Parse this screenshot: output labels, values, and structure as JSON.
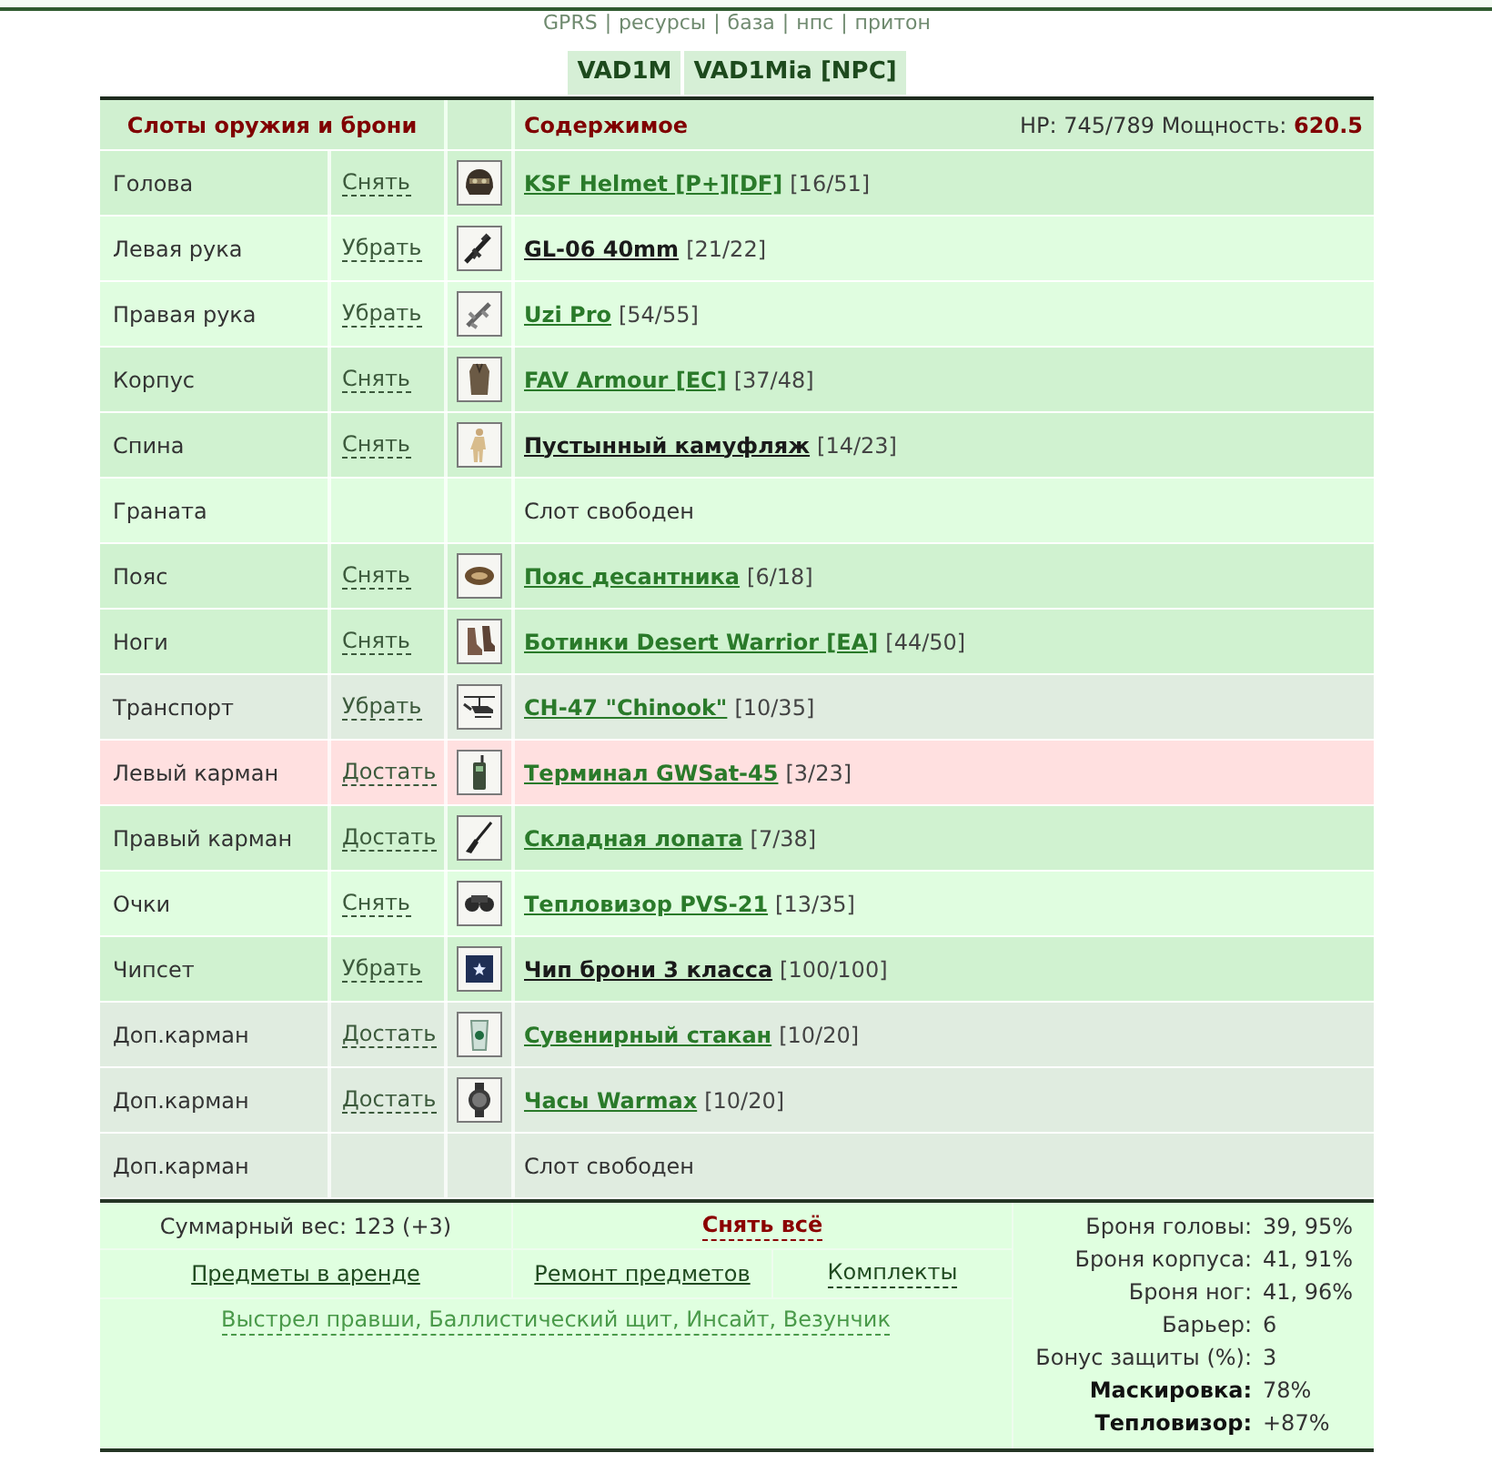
{
  "top_nav": {
    "links": [
      "GPRS",
      "ресурсы",
      "база",
      "нпс",
      "притон"
    ],
    "separator": "|"
  },
  "character_tabs": [
    {
      "label": "VAD1M"
    },
    {
      "label": "VAD1Mia [NPC]"
    }
  ],
  "table": {
    "columns": [
      "Слоты оружия и брони",
      "Содержимое"
    ],
    "stats": "HP: 745/789 Мощность: **620.5**",
    "rows": [
      {
        "slot": "Голова",
        "kind": "item",
        "action": "Снять",
        "color": "#d0f2d0",
        "item": {
          "name": "KSF Helmet [P+][DF]",
          "durability": "[16/51]",
          "color": "#2a7a2a"
        }
      },
      {
        "slot": "Левая рука",
        "kind": "item",
        "action": "Убрать",
        "color": "#e0fde0",
        "item": {
          "name": "GL-06 40mm",
          "durability": "[21/22]",
          "color": "#1a1a1a"
        }
      },
      {
        "slot": "Правая рука",
        "kind": "item",
        "action": "Убрать",
        "color": "#e0fde0",
        "item": {
          "name": "Uzi Pro",
          "durability": "[54/55]",
          "color": "#2a7a2a"
        }
      },
      {
        "slot": "Корпус",
        "kind": "item",
        "action": "Снять",
        "color": "#d0f2d0",
        "item": {
          "name": "FAV Armour [EC]",
          "durability": "[37/48]",
          "color": "#2a7a2a"
        }
      },
      {
        "slot": "Спина",
        "kind": "item",
        "action": "Снять",
        "color": "#d0f2d0",
        "item": {
          "name": "Пустынный камуфляж",
          "durability": "[14/23]",
          "color": "#1a1a1a"
        }
      },
      {
        "slot": "Граната",
        "kind": "empty",
        "color": "#e0fde0",
        "text": "Слот свободен"
      },
      {
        "slot": "Пояс",
        "kind": "item",
        "action": "Снять",
        "color": "#d0f2d0",
        "item": {
          "name": "Пояс десантника",
          "durability": "[6/18]",
          "color": "#2a7a2a"
        }
      },
      {
        "slot": "Ноги",
        "kind": "item",
        "action": "Снять",
        "color": "#d0f2d0",
        "item": {
          "name": "Ботинки Desert Warrior [EA]",
          "durability": "[44/50]",
          "color": "#2a7a2a"
        }
      },
      {
        "slot": "Транспорт",
        "kind": "item",
        "action": "Убрать",
        "color": "#e0ece0",
        "item": {
          "name": "CH-47 \"Chinook\"",
          "durability": "[10/35]",
          "color": "#2a7a2a"
        }
      },
      {
        "slot": "Левый карман",
        "kind": "item",
        "action": "Достать",
        "color": "#ffe0e0",
        "item": {
          "name": "Терминал GWSat-45",
          "durability": "[3/23]",
          "color": "#2a7a2a"
        }
      },
      {
        "slot": "Правый карман",
        "kind": "item",
        "action": "Достать",
        "color": "#d0f2d0",
        "item": {
          "name": "Складная лопата",
          "durability": "[7/38]",
          "color": "#2a7a2a"
        }
      },
      {
        "slot": "Очки",
        "kind": "item",
        "action": "Снять",
        "color": "#e0fde0",
        "item": {
          "name": "Тепловизор PVS-21",
          "durability": "[13/35]",
          "color": "#2a7a2a"
        }
      },
      {
        "slot": "Чипсет",
        "kind": "item",
        "action": "Убрать",
        "color": "#d0f2d0",
        "item": {
          "name": "Чип брони 3 класса",
          "durability": "[100/100]",
          "color": "#1a1a1a"
        }
      },
      {
        "slot": "Доп.карман",
        "kind": "item",
        "action": "Достать",
        "color": "#e0ece0",
        "item": {
          "name": "Сувенирный стакан",
          "durability": "[10/20]",
          "color": "#2a7a2a"
        }
      },
      {
        "slot": "Доп.карман",
        "kind": "item",
        "action": "Достать",
        "color": "#e0ece0",
        "item": {
          "name": "Часы Warmax",
          "durability": "[10/20]",
          "color": "#2a7a2a"
        }
      },
      {
        "slot": "Доп.карман",
        "kind": "empty",
        "color": "#e0ece0",
        "text": "Слот свободен"
      }
    ]
  },
  "footer": {
    "weight": "Суммарный вес: 123 (+3)",
    "remove_all": "Снять всё",
    "links": [
      {
        "label": "Предметы в аренде",
        "kind": "solid"
      },
      {
        "label": "Ремонт предметов",
        "kind": "solid"
      },
      {
        "label": "Комплекты",
        "kind": "dashed"
      }
    ],
    "abilities": "Выстрел правши, Баллистический щит, Инсайт, Везунчик",
    "stats": [
      {
        "label": "Броня головы:",
        "value": "39, 95%",
        "bold": false
      },
      {
        "label": "Броня корпуса:",
        "value": "41, 91%",
        "bold": false
      },
      {
        "label": "Броня ног:",
        "value": "41, 96%",
        "bold": false
      },
      {
        "label": "Барьер:",
        "value": "6",
        "bold": false
      },
      {
        "label": "Бонус защиты (%):",
        "value": "3",
        "bold": false
      },
      {
        "label": "Маскировка:",
        "value": "78%",
        "bold": true
      },
      {
        "label": "Тепловизор:",
        "value": "+87%",
        "bold": true
      }
    ]
  }
}
